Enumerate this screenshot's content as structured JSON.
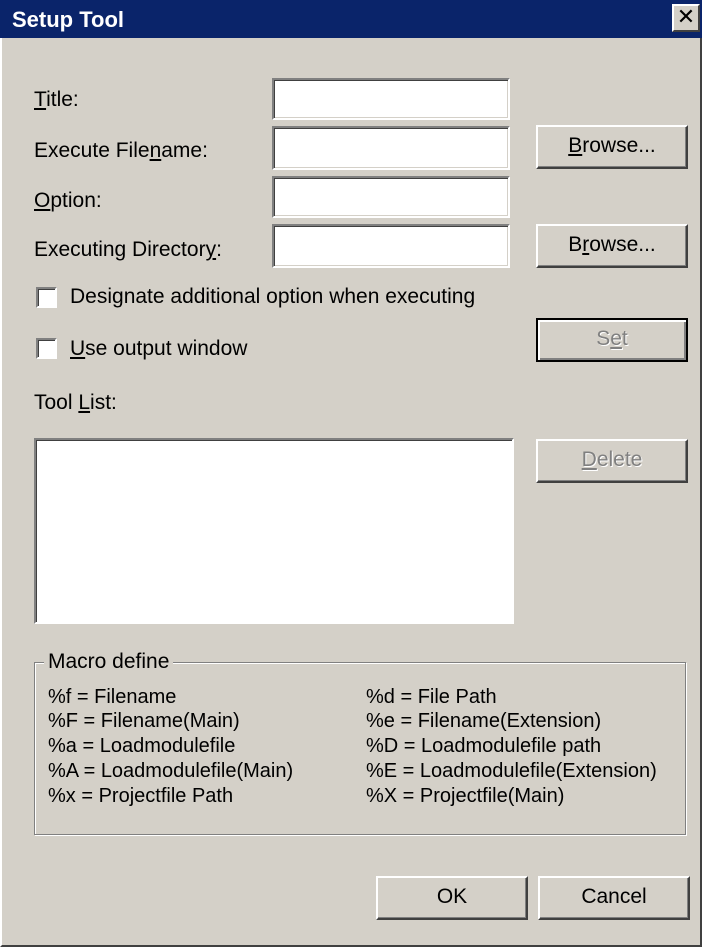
{
  "window": {
    "title": "Setup Tool",
    "close_glyph": "✕"
  },
  "form": {
    "title_label_u": "T",
    "title_label_rest": "itle:",
    "title_value": "",
    "exec_label_pre": "Execute File",
    "exec_label_u": "n",
    "exec_label_post": "ame:",
    "exec_value": "",
    "option_label_u": "O",
    "option_label_rest": "ption:",
    "option_value": "",
    "dir_label_pre": "Executing Director",
    "dir_label_u": "y",
    "dir_label_post": ":",
    "dir_value": "",
    "browse1_u": "B",
    "browse1_rest": "rowse...",
    "browse2_pre": "B",
    "browse2_u": "r",
    "browse2_post": "owse..."
  },
  "checks": {
    "designate_pre": "Designate additional option when executing",
    "designate_checked": false,
    "output_u": "U",
    "output_rest": "se output window",
    "output_checked": false
  },
  "buttons": {
    "set_pre": "S",
    "set_u": "e",
    "set_post": "t",
    "delete_u": "D",
    "delete_rest": "elete",
    "ok": "OK",
    "cancel": "Cancel"
  },
  "toollist": {
    "label_pre": "Tool ",
    "label_u": "L",
    "label_post": "ist:",
    "items": []
  },
  "macro": {
    "legend": "Macro define",
    "left": [
      "%f = Filename",
      "%F = Filename(Main)",
      "%a = Loadmodulefile",
      "%A = Loadmodulefile(Main)",
      "%x = Projectfile Path"
    ],
    "right": [
      "%d = File Path",
      "%e = Filename(Extension)",
      "%D = Loadmodulefile path",
      "%E = Loadmodulefile(Extension)",
      "%X = Projectfile(Main)"
    ]
  }
}
